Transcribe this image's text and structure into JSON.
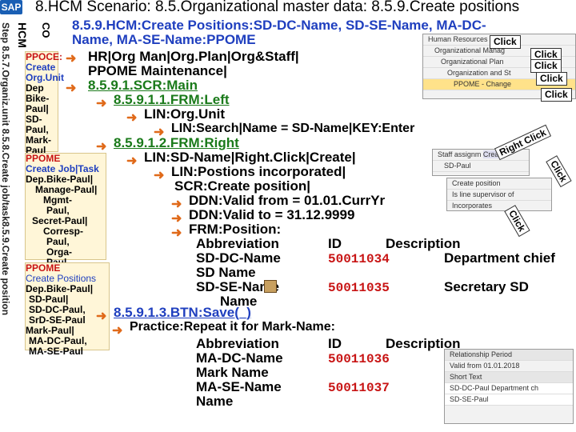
{
  "header": {
    "logo": "SAP",
    "title": "8.HCM Scenario: 8.5.Organizational master data: 8.5.9.Create positions"
  },
  "side": {
    "step": "Step 8.5.7.Organiz.unit 8.5.8.Create job/task8.5.9.Create position",
    "hcm": "HCM",
    "co": "CO"
  },
  "sidebox1": [
    "PPOCE:",
    "Create",
    "Org.Unit",
    "Dep",
    "Bike-",
    "Paul|",
    "SD-",
    "Paul,",
    "Mark-",
    "Paul"
  ],
  "sidebox2": [
    "PPOME",
    "Create Job|Task",
    "Dep.Bike-Paul|",
    "Manage-Paul|",
    "Mgmt-",
    "Paul,",
    "Secret-Paul|",
    "Corresp-",
    "Paul,",
    "Orga-",
    "Paul"
  ],
  "sidebox3": [
    "PPOME",
    "Create Positions",
    "Dep.Bike-Paul|",
    "SD-Paul|",
    "SD-DC-Paul,",
    "SrD-SE-Paul",
    "Mark-Paul|",
    "MA-DC-Paul,",
    "MA-SE-Paul"
  ],
  "main": {
    "line1": "8.5.9.HCM:Create Positions:SD-DC-Name, SD-SE-Name, MA-DC-",
    "line2": "Name, MA-SE-Name:PPOME",
    "line3": "HR|Org Man|Org.Plan|Org&Staff|",
    "line4": "PPOME Maintenance|",
    "line5": "8.5.9.1.SCR:Main",
    "line6": "8.5.9.1.1.FRM:Left",
    "line7": "LIN:Org.Unit",
    "line8": "LIN:Search|Name = SD-Name|KEY:Enter",
    "line9": "8.5.9.1.2.FRM:Right",
    "line10": "LIN:SD-Name|Right.Click|Create|",
    "line11": "LIN:Postions incorporated|",
    "line12": "SCR:Create position|",
    "line13": "DDN:Valid from = 01.01.CurrYr",
    "line14": "DDN:Valid to = 31.12.9999",
    "line15": "FRM:Position:",
    "line16": "8.5.9.1.3.BTN:Save(_)",
    "line17": "Practice:Repeat it for Mark-Name:"
  },
  "table1": {
    "headers": [
      "Abbreviation",
      "ID",
      "Description"
    ],
    "rows": [
      [
        "SD-DC-Name",
        "50011034",
        "Department chief"
      ],
      [
        "SD Name",
        "",
        ""
      ],
      [
        "SD-SE-Name",
        "50011035",
        "Secretary SD"
      ],
      [
        "Name",
        "",
        ""
      ]
    ]
  },
  "table2": {
    "headers": [
      "Abbreviation",
      "ID",
      "Description"
    ],
    "rows": [
      [
        "MA-DC-Name",
        "50011036"
      ],
      [
        "Mark Name",
        ""
      ],
      [
        "MA-SE-Name",
        "50011037"
      ],
      [
        "Name",
        ""
      ]
    ]
  },
  "callouts": {
    "c1": "Click",
    "c2": "Click",
    "c3": "Click",
    "c4": "Click",
    "c5": "Click",
    "r1": "Right Click",
    "r2": "Click",
    "r3": "Click"
  },
  "shots": {
    "s1": [
      "Human Resources",
      "Organizational Manag",
      "Organizational Plan",
      "Organization and St",
      "PPOME - Change"
    ],
    "s2": [
      "Staff assignm",
      "Create",
      "SD-Paul",
      ""
    ],
    "s3": [
      "Create position",
      "Is line supervisor of",
      "Incorporates"
    ],
    "s4": [
      "Relationship Period",
      "Valid from 01.01.2018",
      "Short Text",
      "SD-DC-Paul Department ch",
      "SD-SE-Paul"
    ]
  },
  "colors": {
    "accent": "#e06a1a",
    "blue": "#1f3fbf",
    "green": "#1a7a1a",
    "red": "#c81414",
    "sidebox": "#fff6d8"
  }
}
